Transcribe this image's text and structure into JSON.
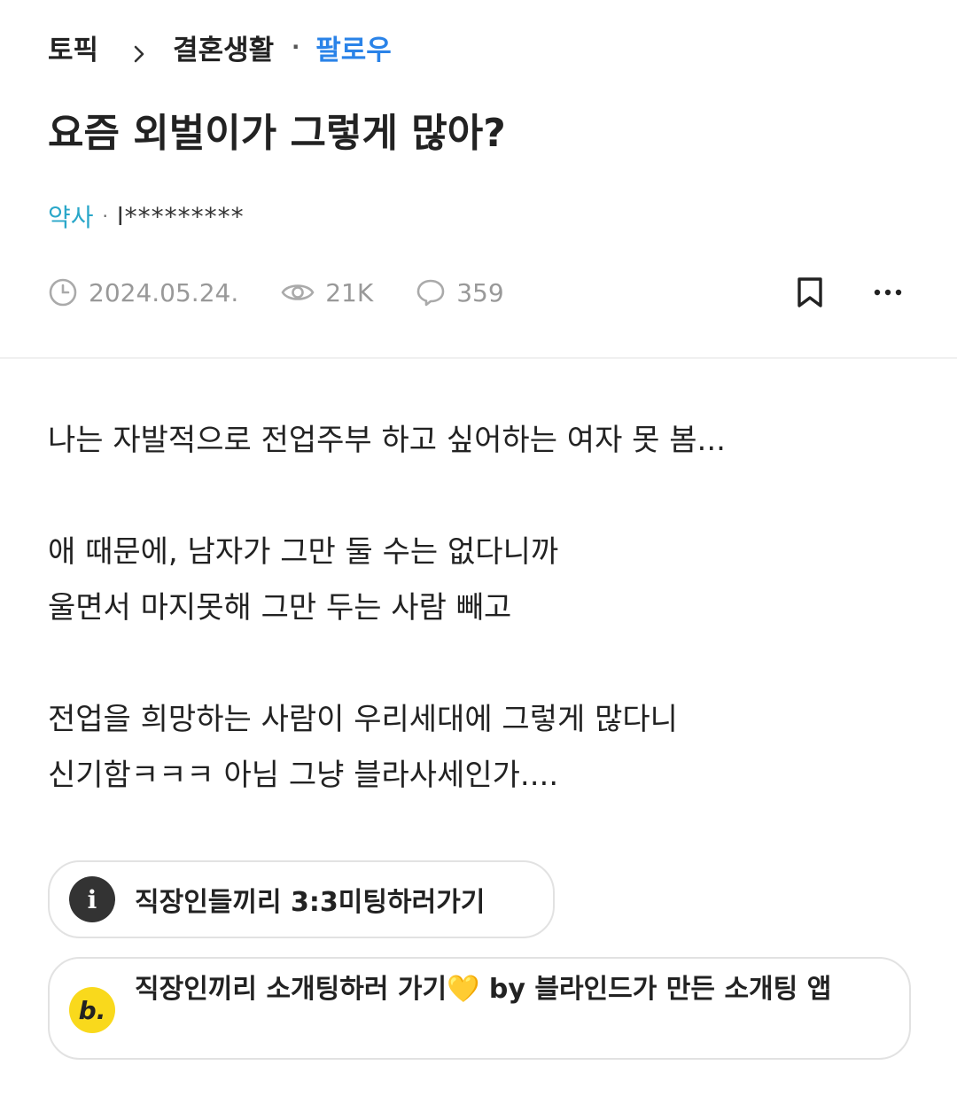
{
  "breadcrumb": {
    "root": "토픽",
    "category": "결혼생활",
    "separator": "·",
    "follow_label": "팔로우"
  },
  "post": {
    "title": "요즘 외벌이가 그렇게 많아?",
    "author": {
      "company": "약사",
      "separator": "·",
      "nickname": "l*********"
    },
    "meta": {
      "date": "2024.05.24.",
      "views": "21K",
      "comments": "359"
    },
    "body": [
      [
        "나는 자발적으로 전업주부 하고 싶어하는 여자 못 봄..."
      ],
      [
        "애 때문에, 남자가 그만 둘 수는 없다니까",
        "울면서 마지못해 그만 두는 사람 빼고"
      ],
      [
        "전업을 희망하는 사람이 우리세대에 그렇게 많다니",
        "신기함ㅋㅋㅋ 아님 그냥 블라사세인가...."
      ]
    ]
  },
  "promos": [
    {
      "icon_label": "i",
      "text": "직장인들끼리 3:3미팅하러가기"
    },
    {
      "icon_label": "b.",
      "text": "직장인끼리 소개팅하러 가기💛 by 블라인드가 만든 소개팅 앱"
    }
  ],
  "icons": {
    "chevron": "chevron-right-icon",
    "clock": "clock-icon",
    "views": "eye-icon",
    "comments": "comment-icon",
    "bookmark": "bookmark-icon",
    "more": "more-icon"
  },
  "colors": {
    "follow": "#2a83e8",
    "company": "#2aa7c9",
    "meta": "#999999",
    "promo_info_icon": "#333333",
    "promo_b_icon": "#f9d91c"
  }
}
